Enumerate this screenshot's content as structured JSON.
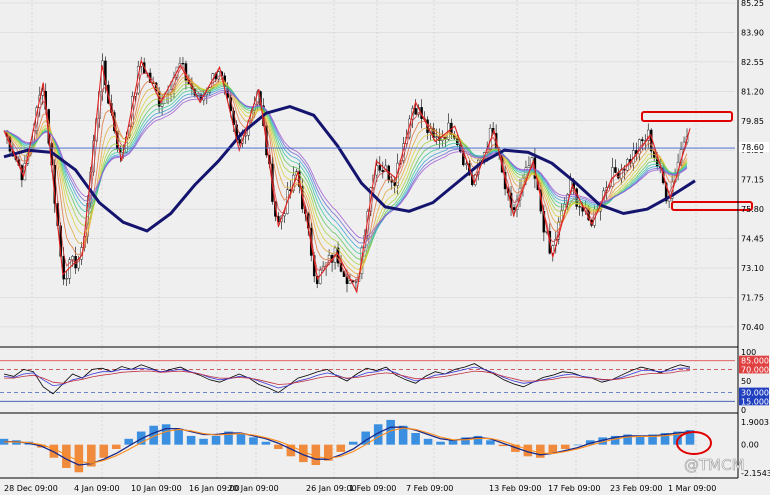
{
  "chart": {
    "price_axis_labels": [
      "85.25",
      "83.90",
      "82.55",
      "81.20",
      "79.85",
      "78.50",
      "77.15",
      "75.80",
      "74.45",
      "73.10",
      "71.75",
      "70.40"
    ],
    "current_price_tag": "78.60",
    "indicator_axis_labels": [
      "100",
      "85.0000",
      "70.0000",
      "50",
      "30.0000",
      "15.0000",
      "0"
    ],
    "macd_axis_labels": [
      "1.9003",
      "0.00",
      "-2.1543"
    ],
    "date_labels": [
      "28 Dec 09:00",
      "4 Jan 09:00",
      "10 Jan 09:00",
      "16 Jan 09:00",
      "20 Jan 09:00",
      "26 Jan 09:00",
      "1 Feb 09:00",
      "7 Feb 09:00",
      "13 Feb 09:00",
      "17 Feb 09:00",
      "23 Feb 09:00",
      "1 Mar 09:00"
    ],
    "watermark": "@TMCM",
    "colors": {
      "background": "#efefef",
      "grid": "#c8c8c8",
      "bull_candle": "#ffffff",
      "bear_candle": "#000000",
      "zigzag": "#e02020",
      "slow_ma": "#14146e",
      "price_line": "#3a5fcd",
      "macd_up": "#3a8fe0",
      "macd_down": "#f08a3c",
      "annotation": "#e00000"
    }
  },
  "chart_data": [
    {
      "type": "candlestick",
      "x": [
        "28 Dec 09:00",
        "4 Jan 09:00",
        "10 Jan 09:00",
        "16 Jan 09:00",
        "20 Jan 09:00",
        "26 Jan 09:00",
        "1 Feb 09:00",
        "7 Feb 09:00",
        "13 Feb 09:00",
        "17 Feb 09:00",
        "23 Feb 09:00",
        "1 Mar 09:00"
      ],
      "ylim": [
        69.8,
        85.25
      ],
      "ylabel": "",
      "zigzag_values": [
        79.4,
        77.3,
        81.6,
        72.8,
        73.7,
        82.4,
        78.0,
        82.6,
        80.7,
        82.4,
        80.7,
        82.3,
        78.5,
        81.3,
        75.0,
        77.5,
        72.6,
        73.8,
        72.0,
        78.0,
        77.2,
        80.7,
        78.9,
        79.6,
        77.0,
        79.4,
        75.5,
        78.0,
        73.6,
        76.9,
        75.1,
        77.2,
        78.0,
        79.2,
        76.3,
        79.5
      ],
      "slow_ma_values": [
        78.2,
        78.5,
        78.4,
        77.6,
        76.1,
        75.2,
        74.8,
        75.6,
        76.9,
        78.0,
        79.3,
        80.2,
        80.5,
        80.1,
        78.7,
        77.0,
        75.9,
        75.7,
        76.1,
        77.0,
        77.9,
        78.5,
        78.4,
        77.9,
        77.0,
        76.0,
        75.6,
        75.8,
        76.4,
        77.1
      ],
      "current_price": 78.6
    },
    {
      "type": "line",
      "title": "",
      "ylim": [
        0,
        100
      ],
      "levels": [
        85,
        70,
        30,
        15
      ],
      "series": [
        {
          "values": [
            62,
            58,
            70,
            66,
            40,
            28,
            45,
            62,
            55,
            70,
            72,
            66,
            75,
            70,
            78,
            72,
            65,
            70,
            74,
            66,
            60,
            52,
            48,
            55,
            62,
            55,
            44,
            38,
            30,
            42,
            55,
            60,
            66,
            70,
            58,
            50,
            62,
            72,
            68,
            74,
            60,
            52,
            46,
            58,
            66,
            62,
            70,
            74,
            80,
            70,
            62,
            52,
            45,
            40,
            48,
            56,
            60,
            66,
            64,
            58,
            55,
            48,
            52,
            60,
            68,
            74,
            70,
            64,
            72,
            78,
            74
          ]
        },
        {
          "values": [
            58,
            56,
            62,
            64,
            52,
            42,
            44,
            52,
            56,
            62,
            66,
            66,
            70,
            70,
            72,
            70,
            66,
            68,
            70,
            66,
            62,
            56,
            52,
            54,
            58,
            56,
            50,
            44,
            38,
            42,
            50,
            54,
            60,
            64,
            60,
            54,
            58,
            64,
            66,
            70,
            64,
            56,
            50,
            54,
            60,
            62,
            66,
            70,
            74,
            70,
            64,
            56,
            50,
            46,
            48,
            52,
            56,
            60,
            62,
            58,
            56,
            52,
            52,
            56,
            62,
            68,
            68,
            66,
            68,
            72,
            72
          ]
        },
        {
          "values": [
            55,
            55,
            58,
            60,
            55,
            48,
            46,
            50,
            53,
            57,
            60,
            62,
            65,
            66,
            67,
            67,
            65,
            66,
            67,
            65,
            62,
            58,
            55,
            55,
            56,
            55,
            52,
            48,
            44,
            45,
            48,
            51,
            55,
            58,
            58,
            55,
            56,
            59,
            62,
            64,
            62,
            58,
            54,
            54,
            56,
            58,
            61,
            64,
            67,
            66,
            63,
            58,
            54,
            50,
            50,
            51,
            53,
            56,
            57,
            56,
            55,
            53,
            52,
            54,
            57,
            61,
            63,
            63,
            64,
            67,
            68
          ]
        }
      ]
    },
    {
      "type": "bar",
      "title": "",
      "ylim": [
        -2.1543,
        1.9003
      ],
      "histogram": [
        0.4,
        0.3,
        0.2,
        -0.2,
        -0.9,
        -1.6,
        -1.9,
        -1.5,
        -0.9,
        -0.3,
        0.4,
        0.9,
        1.3,
        1.4,
        1.1,
        0.6,
        0.4,
        0.6,
        0.9,
        0.8,
        0.5,
        0.2,
        -0.3,
        -0.8,
        -1.2,
        -1.4,
        -1.1,
        -0.5,
        0.2,
        0.9,
        1.4,
        1.7,
        1.3,
        0.8,
        0.4,
        0.2,
        0.3,
        0.5,
        0.6,
        0.3,
        -0.1,
        -0.5,
        -0.8,
        -0.9,
        -0.6,
        -0.3,
        0.0,
        0.3,
        0.5,
        0.6,
        0.7,
        0.6,
        0.7,
        0.8,
        0.9,
        1.0
      ],
      "signal": [
        0.2,
        0.2,
        0.1,
        -0.1,
        -0.5,
        -1.0,
        -1.4,
        -1.3,
        -1.0,
        -0.6,
        -0.1,
        0.4,
        0.8,
        1.1,
        1.1,
        0.9,
        0.7,
        0.7,
        0.8,
        0.8,
        0.6,
        0.4,
        0.1,
        -0.3,
        -0.7,
        -1.0,
        -1.0,
        -0.7,
        -0.3,
        0.3,
        0.8,
        1.2,
        1.2,
        1.0,
        0.7,
        0.4,
        0.3,
        0.4,
        0.5,
        0.4,
        0.1,
        -0.2,
        -0.5,
        -0.7,
        -0.6,
        -0.4,
        -0.2,
        0.1,
        0.3,
        0.5,
        0.6,
        0.6,
        0.6,
        0.7,
        0.8,
        0.9
      ]
    }
  ]
}
